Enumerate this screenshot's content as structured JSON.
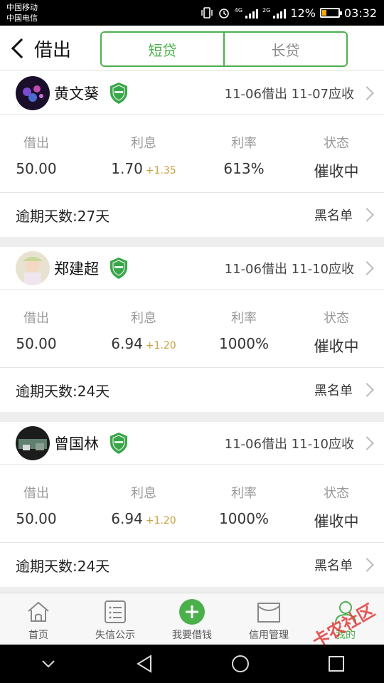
{
  "status_bar": {
    "carrier1": "中国移动",
    "carrier2": "中国电信",
    "net1": "4G",
    "net2": "2G",
    "battery": "12%",
    "time": "03:32"
  },
  "header": {
    "title": "借出",
    "tabs": [
      {
        "label": "短贷",
        "active": true
      },
      {
        "label": "长贷",
        "active": false
      }
    ]
  },
  "columns": {
    "lent": "借出",
    "interest": "利息",
    "rate": "利率",
    "status": "状态"
  },
  "loans": [
    {
      "name": "黄文葵",
      "dates": "11-06借出 11-07应收",
      "lent": "50.00",
      "interest": "1.70",
      "interest_delta": "+1.35",
      "rate": "613%",
      "status": "催收中",
      "overdue": "逾期天数:27天",
      "blacklist": "黑名单"
    },
    {
      "name": "郑建超",
      "dates": "11-06借出 11-10应收",
      "lent": "50.00",
      "interest": "6.94",
      "interest_delta": "+1.20",
      "rate": "1000%",
      "status": "催收中",
      "overdue": "逾期天数:24天",
      "blacklist": "黑名单"
    },
    {
      "name": "曾国林",
      "dates": "11-06借出 11-10应收",
      "lent": "50.00",
      "interest": "6.94",
      "interest_delta": "+1.20",
      "rate": "1000%",
      "status": "催收中",
      "overdue": "逾期天数:24天",
      "blacklist": "黑名单"
    }
  ],
  "tabbar": [
    {
      "label": "首页",
      "icon": "home-icon"
    },
    {
      "label": "失信公示",
      "icon": "list-icon"
    },
    {
      "label": "我要借钱",
      "icon": "plus-circle-icon"
    },
    {
      "label": "信用管理",
      "icon": "envelope-icon"
    },
    {
      "label": "我的",
      "icon": "user-icon",
      "active": true
    }
  ],
  "watermark": "卡农社区",
  "colors": {
    "accent": "#4bb04b",
    "increment": "#c8a03c",
    "page_bg": "#eeeeee"
  }
}
